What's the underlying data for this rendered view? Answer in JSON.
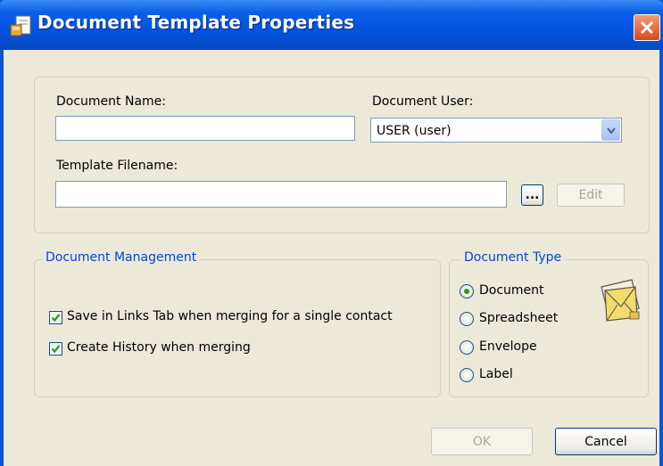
{
  "window": {
    "title": "Document Template Properties",
    "accent_color": "#0254e0",
    "title_icon": "document-template-icon",
    "close_icon": "close-icon"
  },
  "form": {
    "document_name_label": "Document Name:",
    "document_name_value": "",
    "document_user_label": "Document User:",
    "document_user_value": "USER (user)",
    "template_filename_label": "Template Filename:",
    "template_filename_value": "",
    "browse_label": "...",
    "edit_label": "Edit"
  },
  "document_management": {
    "legend": "Document Management",
    "options": [
      {
        "label": "Save in Links Tab when merging for a single contact",
        "checked": true
      },
      {
        "label": "Create History when merging",
        "checked": true
      }
    ]
  },
  "document_type": {
    "legend": "Document Type",
    "selected": "Document",
    "options": [
      {
        "label": "Document"
      },
      {
        "label": "Spreadsheet"
      },
      {
        "label": "Envelope"
      },
      {
        "label": "Label"
      }
    ],
    "icon": "envelope-letter-icon"
  },
  "footer": {
    "ok_label": "OK",
    "cancel_label": "Cancel"
  }
}
